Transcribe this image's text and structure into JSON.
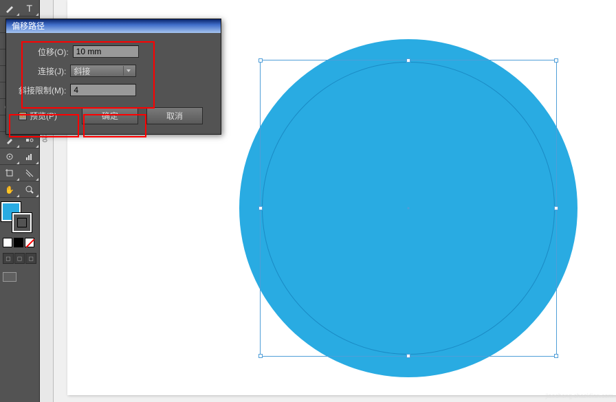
{
  "dialog": {
    "title": "偏移路径",
    "offset_label": "位移(O):",
    "offset_value": "10 mm",
    "join_label": "连接(J):",
    "join_value": "斜接",
    "miter_label": "斜接限制(M):",
    "miter_value": "4",
    "preview_label": "预览(P)",
    "preview_checked": "☑",
    "ok_label": "确定",
    "cancel_label": "取消"
  },
  "colors": {
    "shape_fill": "#29abe2",
    "selection": "#4f9ed8"
  },
  "ruler": {
    "tick_220": "220"
  },
  "watermark": {
    "line1": "查字典 | 教程网",
    "line2": "jiaocheng.chazidian.com"
  },
  "tools": {
    "type": "T",
    "hand": "✋",
    "zoom": "🔍"
  }
}
